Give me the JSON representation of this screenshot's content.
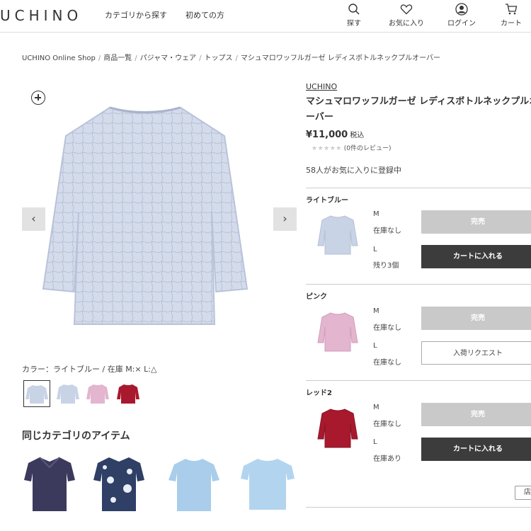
{
  "header": {
    "logo": "UCHINO",
    "nav": [
      "カテゴリから探す",
      "初めての方"
    ],
    "icons": [
      {
        "name": "search-icon",
        "label": "探す"
      },
      {
        "name": "heart-icon",
        "label": "お気に入り"
      },
      {
        "name": "user-icon",
        "label": "ログイン"
      },
      {
        "name": "cart-icon",
        "label": "カート"
      }
    ]
  },
  "breadcrumb": [
    "UCHINO Online Shop",
    "商品一覧",
    "パジャマ・ウェア",
    "トップス",
    "マシュマロワッフルガーゼ レディスボトルネックプルオーバー"
  ],
  "gallery": {
    "color_stock_text": "カラー：ライトブルー / 在庫 M:× L:△",
    "thumbnail_colors": [
      "#c9d3e6",
      "#c9d3e6",
      "#e3b5cf",
      "#a8192e"
    ]
  },
  "product": {
    "brand": "UCHINO",
    "title": "マシュマロワッフルガーゼ レディスボトルネックプルオーバー",
    "price": "¥11,000",
    "tax": "税込",
    "stars": "★★★★★",
    "reviews": "(0件のレビュー)",
    "favorites": "58人がお気に入りに登録中",
    "variants": [
      {
        "label": "ライトブルー",
        "color": "#c9d3e6",
        "sizes": [
          {
            "size": "M",
            "stock": "在庫なし",
            "button": "完売"
          },
          {
            "size": "L",
            "stock": "残り3個",
            "button": "カートに入れる"
          }
        ]
      },
      {
        "label": "ピンク",
        "color": "#e3b5cf",
        "sizes": [
          {
            "size": "M",
            "stock": "在庫なし",
            "button": "完売"
          },
          {
            "size": "L",
            "stock": "在庫なし",
            "button": "入荷リクエスト"
          }
        ]
      },
      {
        "label": "レッド2",
        "color": "#a8192e",
        "sizes": [
          {
            "size": "M",
            "stock": "在庫なし",
            "button": "完売"
          },
          {
            "size": "L",
            "stock": "在庫あり",
            "button": "カートに入れる"
          }
        ]
      }
    ],
    "store_button": "店"
  },
  "related": {
    "title": "同じカテゴリのアイテム",
    "item_colors": [
      "#3b3a5c",
      "#2f3f66",
      "#a9cdea",
      "#b3d4ee"
    ]
  }
}
